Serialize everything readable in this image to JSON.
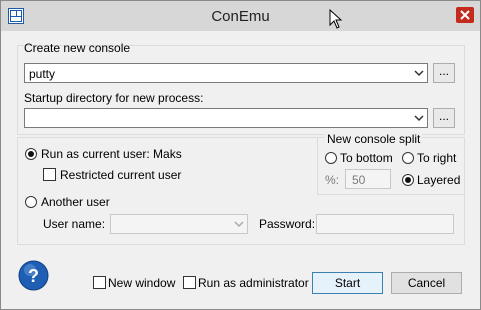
{
  "window": {
    "title": "ConEmu",
    "app_icon": "conemu-app-icon",
    "close_icon": "close-icon"
  },
  "create_console": {
    "heading": "Create new console",
    "command_value": "putty",
    "browse_label": "...",
    "startup_dir_label": "Startup directory for new process:",
    "startup_dir_value": "",
    "browse2_label": "..."
  },
  "split": {
    "heading": "New console split",
    "to_bottom": "To bottom",
    "to_right": "To right",
    "percent_label": "%:",
    "percent_value": "50",
    "layered": "Layered"
  },
  "user": {
    "run_as_current": "Run as current user: Maks",
    "restricted": "Restricted current user",
    "another": "Another user",
    "username_label": "User name:",
    "password_label": "Password:"
  },
  "footer": {
    "new_window": "New window",
    "run_as_admin": "Run as administrator",
    "start": "Start",
    "cancel": "Cancel",
    "help_icon": "help-icon"
  },
  "colors": {
    "titlebar": "#d7d7d7",
    "close_red": "#c42b1c",
    "help_blue": "#1f5fb3",
    "default_button_border": "#3c7fb1"
  }
}
